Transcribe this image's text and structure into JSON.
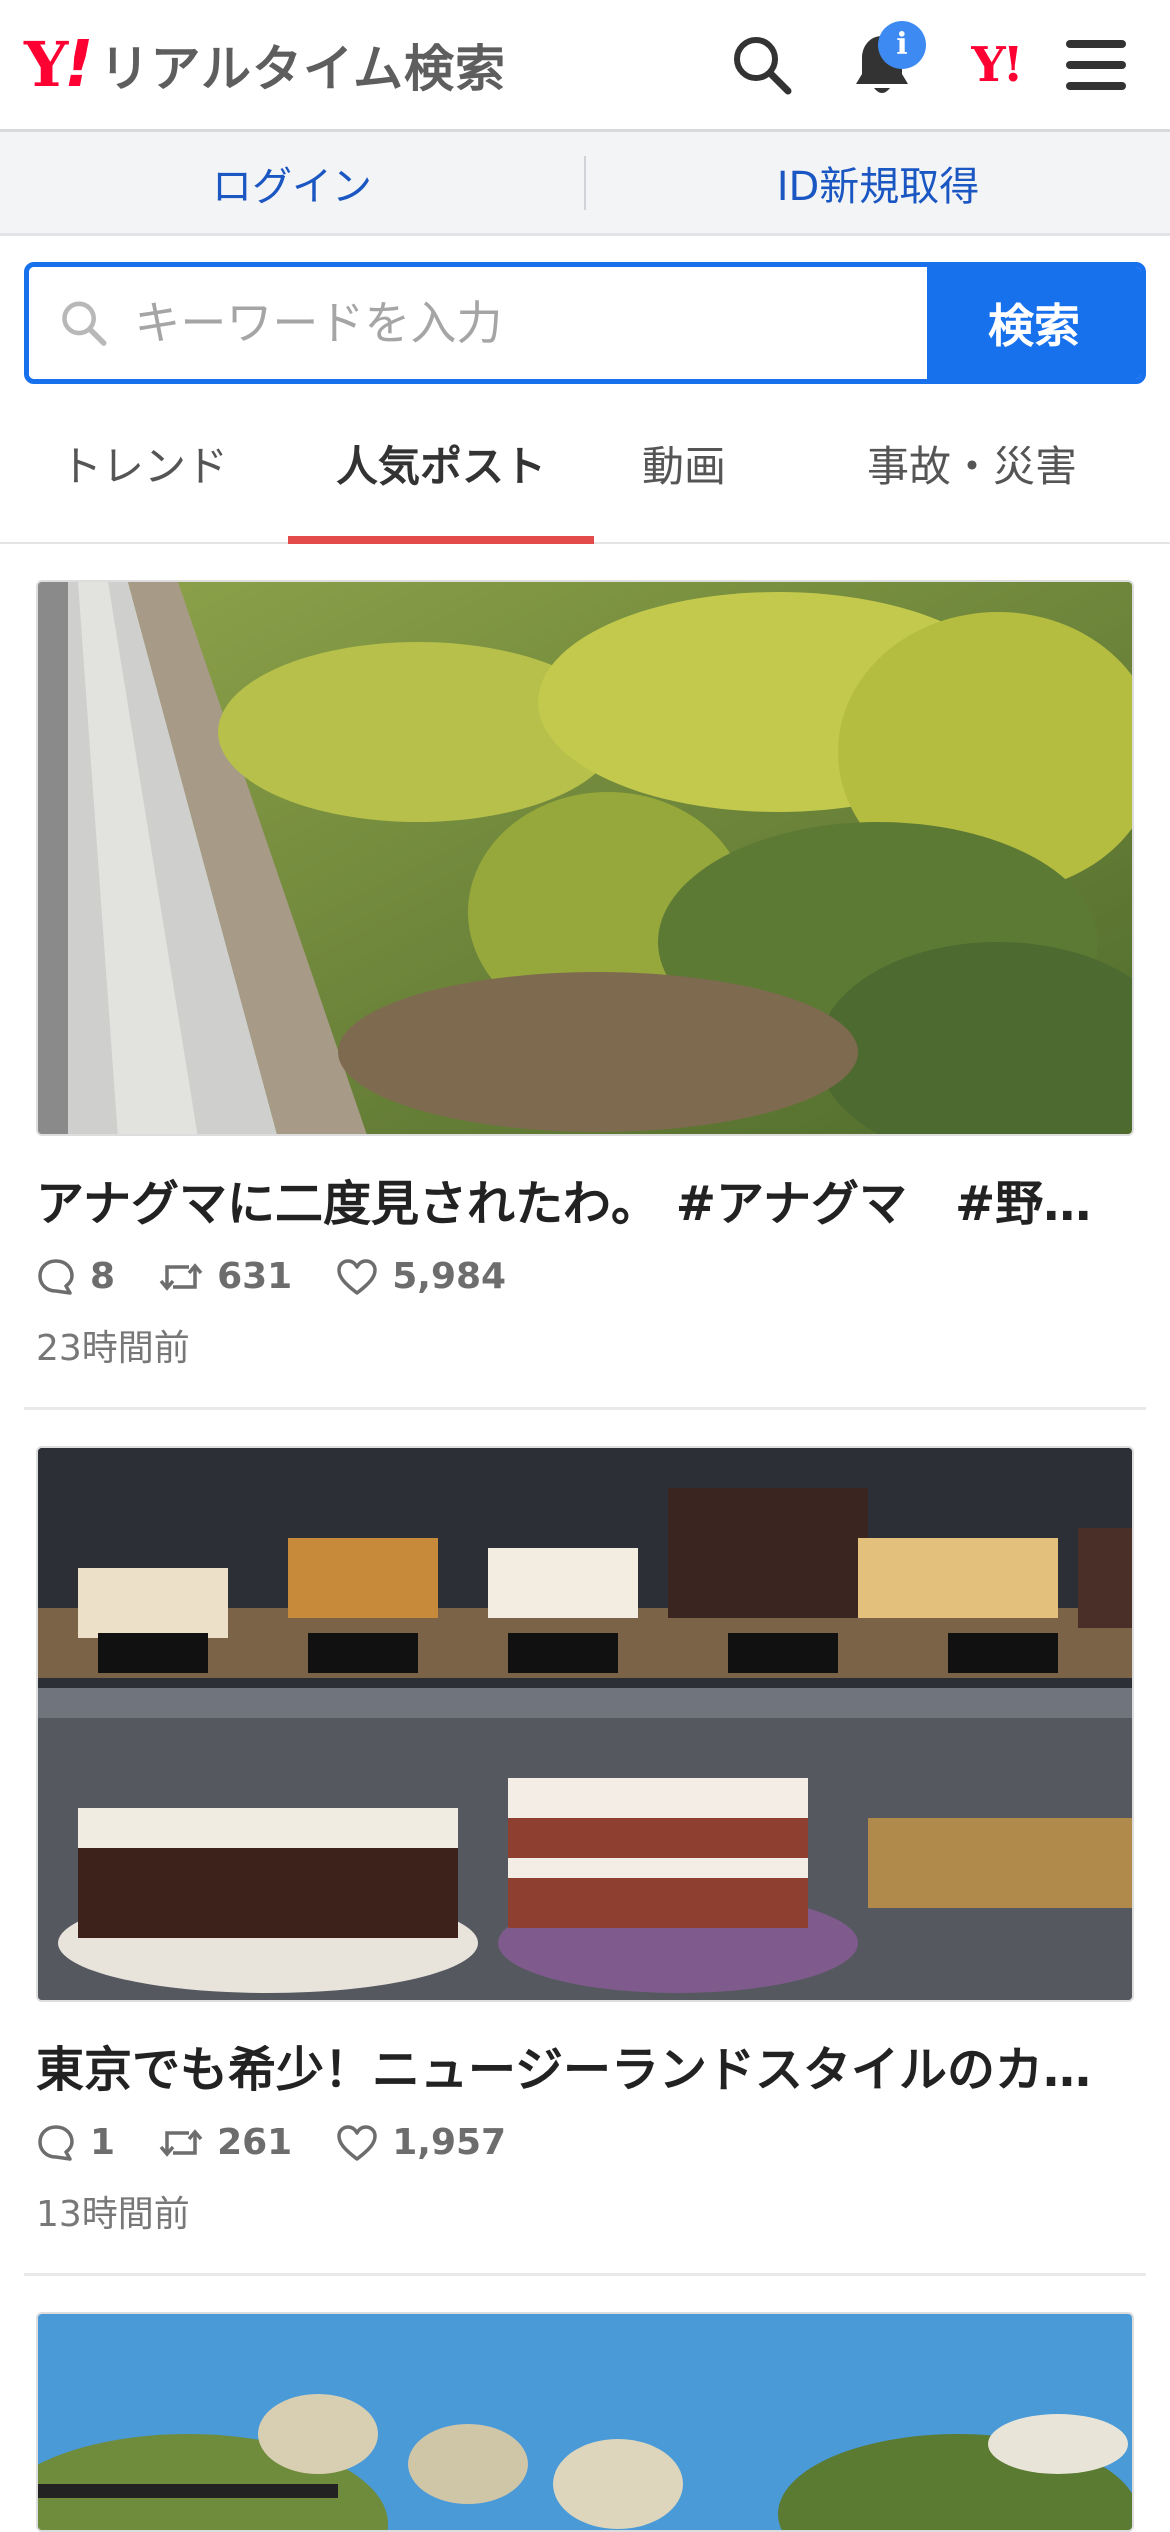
{
  "header": {
    "logo_text": "Y!",
    "service_name": "リアルタイム検索",
    "notification_badge": "i",
    "yahoo_mini_logo": "Y!",
    "icons": [
      "search-icon",
      "bell-icon",
      "menu-icon"
    ]
  },
  "login_bar": {
    "login": "ログイン",
    "register": "ID新規取得"
  },
  "search": {
    "placeholder": "キーワードを入力",
    "button": "検索"
  },
  "tabs": [
    {
      "label": "トレンド",
      "active": false
    },
    {
      "label": "人気ポスト",
      "active": true
    },
    {
      "label": "動画",
      "active": false
    },
    {
      "label": "事故・災害",
      "active": false
    }
  ],
  "posts": [
    {
      "title": "アナグマに二度見されたわ。 #アナグマ　#野生動物",
      "replies": "8",
      "reposts": "631",
      "likes": "5,984",
      "time": "23時間前"
    },
    {
      "title": "東京でも希少！ニュージーランドスタイルのカフェ",
      "replies": "1",
      "reposts": "261",
      "likes": "1,957",
      "time": "13時間前"
    }
  ],
  "colors": {
    "brand_red": "#ff0033",
    "accent_blue": "#1770ec",
    "tab_underline": "#e24b49",
    "link_blue": "#1b57c2"
  }
}
